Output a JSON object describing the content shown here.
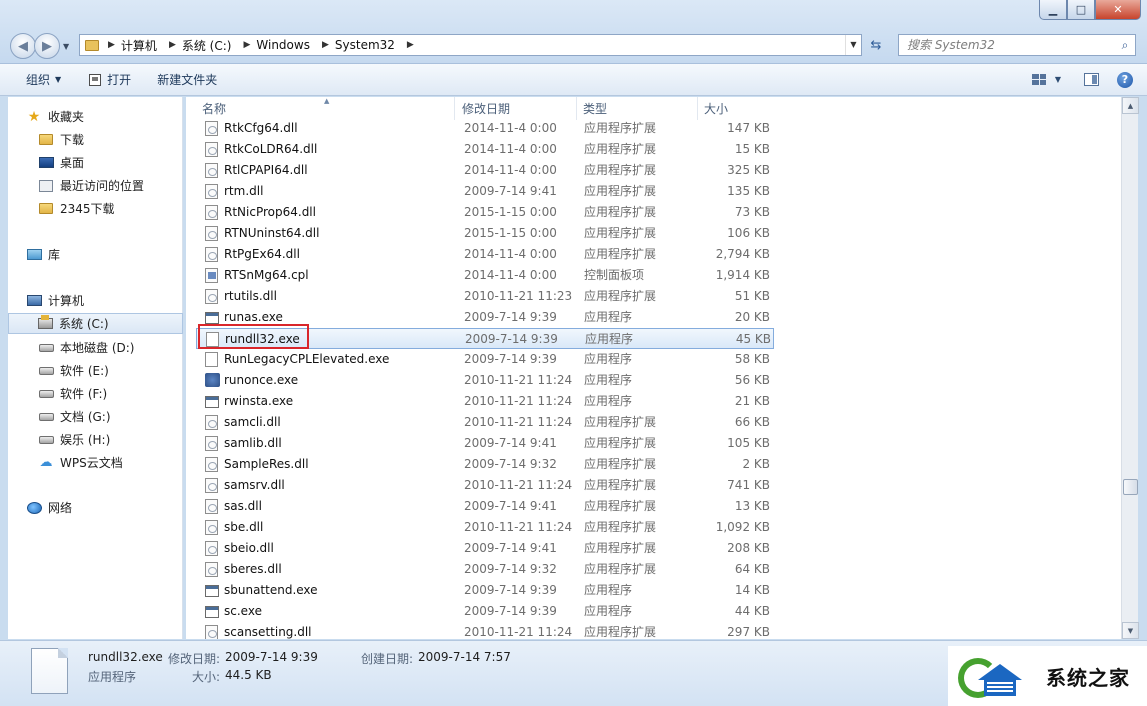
{
  "window": {
    "controls": {
      "minimize": "▁",
      "maximize": "□",
      "close": "✕"
    }
  },
  "address": {
    "crumbs": [
      "计算机",
      "系统 (C:)",
      "Windows",
      "System32"
    ]
  },
  "search": {
    "placeholder": "搜索 System32"
  },
  "toolbar": {
    "organize": "组织",
    "open": "打开",
    "new_folder": "新建文件夹"
  },
  "sidebar": {
    "favorites": "收藏夹",
    "downloads": "下载",
    "desktop": "桌面",
    "recent": "最近访问的位置",
    "downloads2345": "2345下载",
    "libraries": "库",
    "computer": "计算机",
    "drive_c": "系统 (C:)",
    "drive_d": "本地磁盘 (D:)",
    "drive_e": "软件 (E:)",
    "drive_f": "软件 (F:)",
    "drive_g": "文档 (G:)",
    "drive_h": "娱乐 (H:)",
    "wps": "WPS云文档",
    "network": "网络"
  },
  "columns": {
    "name": "名称",
    "date": "修改日期",
    "type": "类型",
    "size": "大小"
  },
  "files": [
    {
      "name": "RtkCfg64.dll",
      "date": "2014-11-4 0:00",
      "type": "应用程序扩展",
      "size": "147 KB",
      "icon": "dll"
    },
    {
      "name": "RtkCoLDR64.dll",
      "date": "2014-11-4 0:00",
      "type": "应用程序扩展",
      "size": "15 KB",
      "icon": "dll"
    },
    {
      "name": "RtlCPAPI64.dll",
      "date": "2014-11-4 0:00",
      "type": "应用程序扩展",
      "size": "325 KB",
      "icon": "dll"
    },
    {
      "name": "rtm.dll",
      "date": "2009-7-14 9:41",
      "type": "应用程序扩展",
      "size": "135 KB",
      "icon": "dll"
    },
    {
      "name": "RtNicProp64.dll",
      "date": "2015-1-15 0:00",
      "type": "应用程序扩展",
      "size": "73 KB",
      "icon": "dll"
    },
    {
      "name": "RTNUninst64.dll",
      "date": "2015-1-15 0:00",
      "type": "应用程序扩展",
      "size": "106 KB",
      "icon": "dll"
    },
    {
      "name": "RtPgEx64.dll",
      "date": "2014-11-4 0:00",
      "type": "应用程序扩展",
      "size": "2,794 KB",
      "icon": "dll"
    },
    {
      "name": "RTSnMg64.cpl",
      "date": "2014-11-4 0:00",
      "type": "控制面板项",
      "size": "1,914 KB",
      "icon": "cpl"
    },
    {
      "name": "rtutils.dll",
      "date": "2010-11-21 11:23",
      "type": "应用程序扩展",
      "size": "51 KB",
      "icon": "dll"
    },
    {
      "name": "runas.exe",
      "date": "2009-7-14 9:39",
      "type": "应用程序",
      "size": "20 KB",
      "icon": "exe"
    },
    {
      "name": "rundll32.exe",
      "date": "2009-7-14 9:39",
      "type": "应用程序",
      "size": "45 KB",
      "icon": "blank",
      "selected": true
    },
    {
      "name": "RunLegacyCPLElevated.exe",
      "date": "2009-7-14 9:39",
      "type": "应用程序",
      "size": "58 KB",
      "icon": "blank"
    },
    {
      "name": "runonce.exe",
      "date": "2010-11-21 11:24",
      "type": "应用程序",
      "size": "56 KB",
      "icon": "setup"
    },
    {
      "name": "rwinsta.exe",
      "date": "2010-11-21 11:24",
      "type": "应用程序",
      "size": "21 KB",
      "icon": "exe"
    },
    {
      "name": "samcli.dll",
      "date": "2010-11-21 11:24",
      "type": "应用程序扩展",
      "size": "66 KB",
      "icon": "dll"
    },
    {
      "name": "samlib.dll",
      "date": "2009-7-14 9:41",
      "type": "应用程序扩展",
      "size": "105 KB",
      "icon": "dll"
    },
    {
      "name": "SampleRes.dll",
      "date": "2009-7-14 9:32",
      "type": "应用程序扩展",
      "size": "2 KB",
      "icon": "dll"
    },
    {
      "name": "samsrv.dll",
      "date": "2010-11-21 11:24",
      "type": "应用程序扩展",
      "size": "741 KB",
      "icon": "dll"
    },
    {
      "name": "sas.dll",
      "date": "2009-7-14 9:41",
      "type": "应用程序扩展",
      "size": "13 KB",
      "icon": "dll"
    },
    {
      "name": "sbe.dll",
      "date": "2010-11-21 11:24",
      "type": "应用程序扩展",
      "size": "1,092 KB",
      "icon": "dll"
    },
    {
      "name": "sbeio.dll",
      "date": "2009-7-14 9:41",
      "type": "应用程序扩展",
      "size": "208 KB",
      "icon": "dll"
    },
    {
      "name": "sberes.dll",
      "date": "2009-7-14 9:32",
      "type": "应用程序扩展",
      "size": "64 KB",
      "icon": "dll"
    },
    {
      "name": "sbunattend.exe",
      "date": "2009-7-14 9:39",
      "type": "应用程序",
      "size": "14 KB",
      "icon": "exe"
    },
    {
      "name": "sc.exe",
      "date": "2009-7-14 9:39",
      "type": "应用程序",
      "size": "44 KB",
      "icon": "exe"
    },
    {
      "name": "scansetting.dll",
      "date": "2010-11-21 11:24",
      "type": "应用程序扩展",
      "size": "297 KB",
      "icon": "dll"
    }
  ],
  "details": {
    "filename": "rundll32.exe",
    "modified_label": "修改日期:",
    "modified": "2009-7-14 9:39",
    "created_label": "创建日期:",
    "created": "2009-7-14 7:57",
    "type": "应用程序",
    "size_label": "大小:",
    "size": "44.5 KB"
  },
  "watermark": {
    "text": "系统之家"
  }
}
